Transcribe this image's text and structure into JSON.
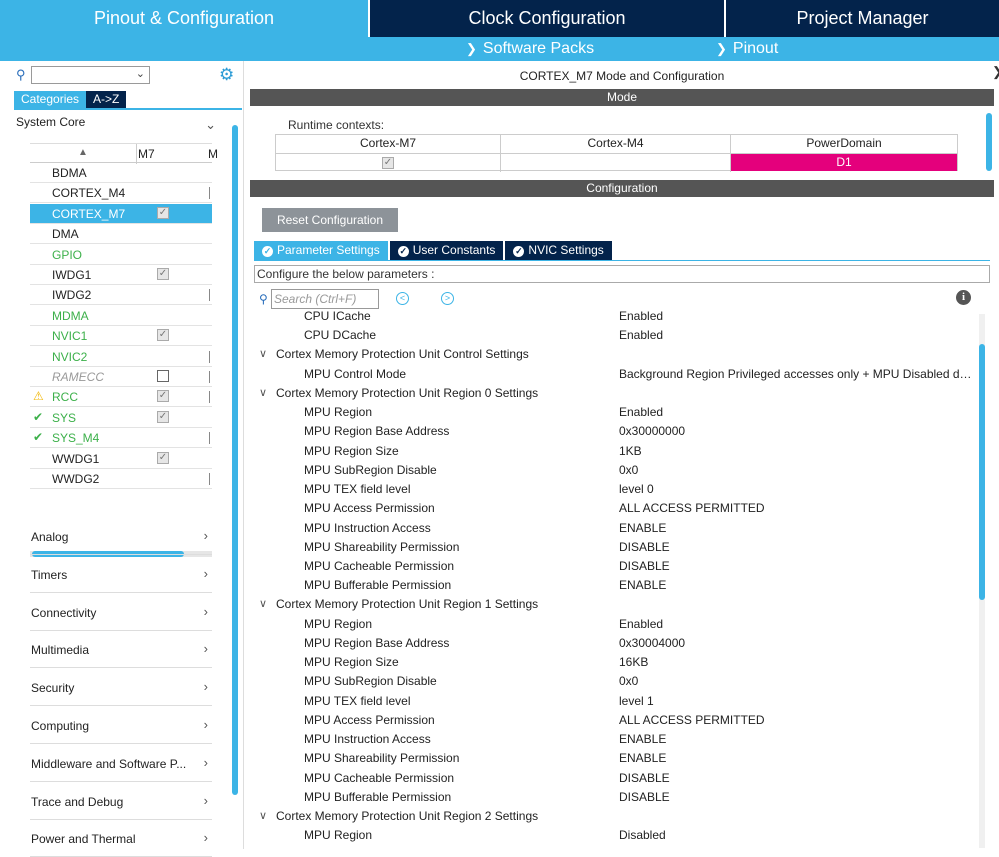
{
  "topbar": {
    "tabs": [
      "Pinout & Configuration",
      "Clock Configuration",
      "Project Manager"
    ],
    "software_packs": "Software Packs",
    "pinout": "Pinout"
  },
  "left": {
    "categories_tab": "Categories",
    "az_tab": "A->Z",
    "system_core": "System Core",
    "col_m7": "M7",
    "col_m": "M",
    "peripherals": [
      {
        "name": "BDMA",
        "m7": "none",
        "m4": false,
        "style": "normal",
        "status": ""
      },
      {
        "name": "CORTEX_M4",
        "m7": "none",
        "m4": true,
        "style": "normal",
        "status": ""
      },
      {
        "name": "CORTEX_M7",
        "m7": "checked",
        "m4": false,
        "style": "normal",
        "status": ""
      },
      {
        "name": "DMA",
        "m7": "none",
        "m4": false,
        "style": "normal",
        "status": ""
      },
      {
        "name": "GPIO",
        "m7": "none",
        "m4": false,
        "style": "green",
        "status": ""
      },
      {
        "name": "IWDG1",
        "m7": "checked",
        "m4": false,
        "style": "normal",
        "status": ""
      },
      {
        "name": "IWDG2",
        "m7": "none",
        "m4": true,
        "style": "normal",
        "status": ""
      },
      {
        "name": "MDMA",
        "m7": "none",
        "m4": false,
        "style": "green",
        "status": ""
      },
      {
        "name": "NVIC1",
        "m7": "checked",
        "m4": false,
        "style": "green",
        "status": ""
      },
      {
        "name": "NVIC2",
        "m7": "none",
        "m4": true,
        "style": "green",
        "status": ""
      },
      {
        "name": "RAMECC",
        "m7": "empty",
        "m4": true,
        "style": "gray",
        "status": ""
      },
      {
        "name": "RCC",
        "m7": "checked",
        "m4": true,
        "style": "green",
        "status": "warning"
      },
      {
        "name": "SYS",
        "m7": "checked",
        "m4": false,
        "style": "green",
        "status": "ok"
      },
      {
        "name": "SYS_M4",
        "m7": "none",
        "m4": true,
        "style": "green",
        "status": "ok"
      },
      {
        "name": "WWDG1",
        "m7": "checked",
        "m4": false,
        "style": "normal",
        "status": ""
      },
      {
        "name": "WWDG2",
        "m7": "none",
        "m4": true,
        "style": "normal",
        "status": ""
      }
    ],
    "selected_peripheral": "CORTEX_M7",
    "other_categories": [
      "Analog",
      "Timers",
      "Connectivity",
      "Multimedia",
      "Security",
      "Computing",
      "Middleware and Software P...",
      "Trace and Debug",
      "Power and Thermal"
    ]
  },
  "right": {
    "title": "CORTEX_M7 Mode and Configuration",
    "mode_bar": "Mode",
    "runtime_contexts": "Runtime contexts:",
    "contexts": [
      "Cortex-M7",
      "Cortex-M4",
      "PowerDomain"
    ],
    "power_domain_value": "D1",
    "configuration_bar": "Configuration",
    "reset_button": "Reset Configuration",
    "tabs": [
      "Parameter Settings",
      "User Constants",
      "NVIC Settings"
    ],
    "configure_text": "Configure the below parameters :",
    "search_placeholder": "Search (Ctrl+F)",
    "parameters": [
      {
        "key": "CPU ICache",
        "value": "Enabled"
      },
      {
        "key": "CPU DCache",
        "value": "Enabled"
      },
      {
        "key": "Cortex Memory Protection Unit Control Settings",
        "section": true
      },
      {
        "key": "MPU Control Mode",
        "value": "Background Region Privileged accesses only + MPU Disabled during hard fault"
      },
      {
        "key": "Cortex Memory Protection Unit Region 0 Settings",
        "section": true
      },
      {
        "key": "MPU Region",
        "value": "Enabled"
      },
      {
        "key": "MPU Region Base Address",
        "value": "0x30000000"
      },
      {
        "key": "MPU Region Size",
        "value": "1KB"
      },
      {
        "key": "MPU SubRegion Disable",
        "value": "0x0"
      },
      {
        "key": "MPU TEX field level",
        "value": "level 0"
      },
      {
        "key": "MPU Access Permission",
        "value": "ALL ACCESS PERMITTED"
      },
      {
        "key": "MPU Instruction Access",
        "value": "ENABLE"
      },
      {
        "key": "MPU Shareability Permission",
        "value": "DISABLE"
      },
      {
        "key": "MPU Cacheable Permission",
        "value": "DISABLE"
      },
      {
        "key": "MPU Bufferable  Permission",
        "value": "ENABLE"
      },
      {
        "key": "Cortex Memory Protection Unit Region 1 Settings",
        "section": true
      },
      {
        "key": "MPU Region",
        "value": "Enabled"
      },
      {
        "key": "MPU Region Base Address",
        "value": "0x30004000"
      },
      {
        "key": "MPU Region Size",
        "value": "16KB"
      },
      {
        "key": "MPU SubRegion Disable",
        "value": "0x0"
      },
      {
        "key": "MPU TEX field level",
        "value": "level 1"
      },
      {
        "key": "MPU Access Permission",
        "value": "ALL ACCESS PERMITTED"
      },
      {
        "key": "MPU Instruction Access",
        "value": "ENABLE"
      },
      {
        "key": "MPU Shareability Permission",
        "value": "ENABLE"
      },
      {
        "key": "MPU Cacheable Permission",
        "value": "DISABLE"
      },
      {
        "key": "MPU Bufferable  Permission",
        "value": "DISABLE"
      },
      {
        "key": "Cortex Memory Protection Unit Region 2 Settings",
        "section": true
      },
      {
        "key": "MPU Region",
        "value": "Disabled"
      }
    ]
  },
  "colors": {
    "accent": "#3cb4e6",
    "dark_navy": "#03234b",
    "power_domain": "#e4007c",
    "green_status": "#3cb04a",
    "warning": "#f2b705"
  }
}
